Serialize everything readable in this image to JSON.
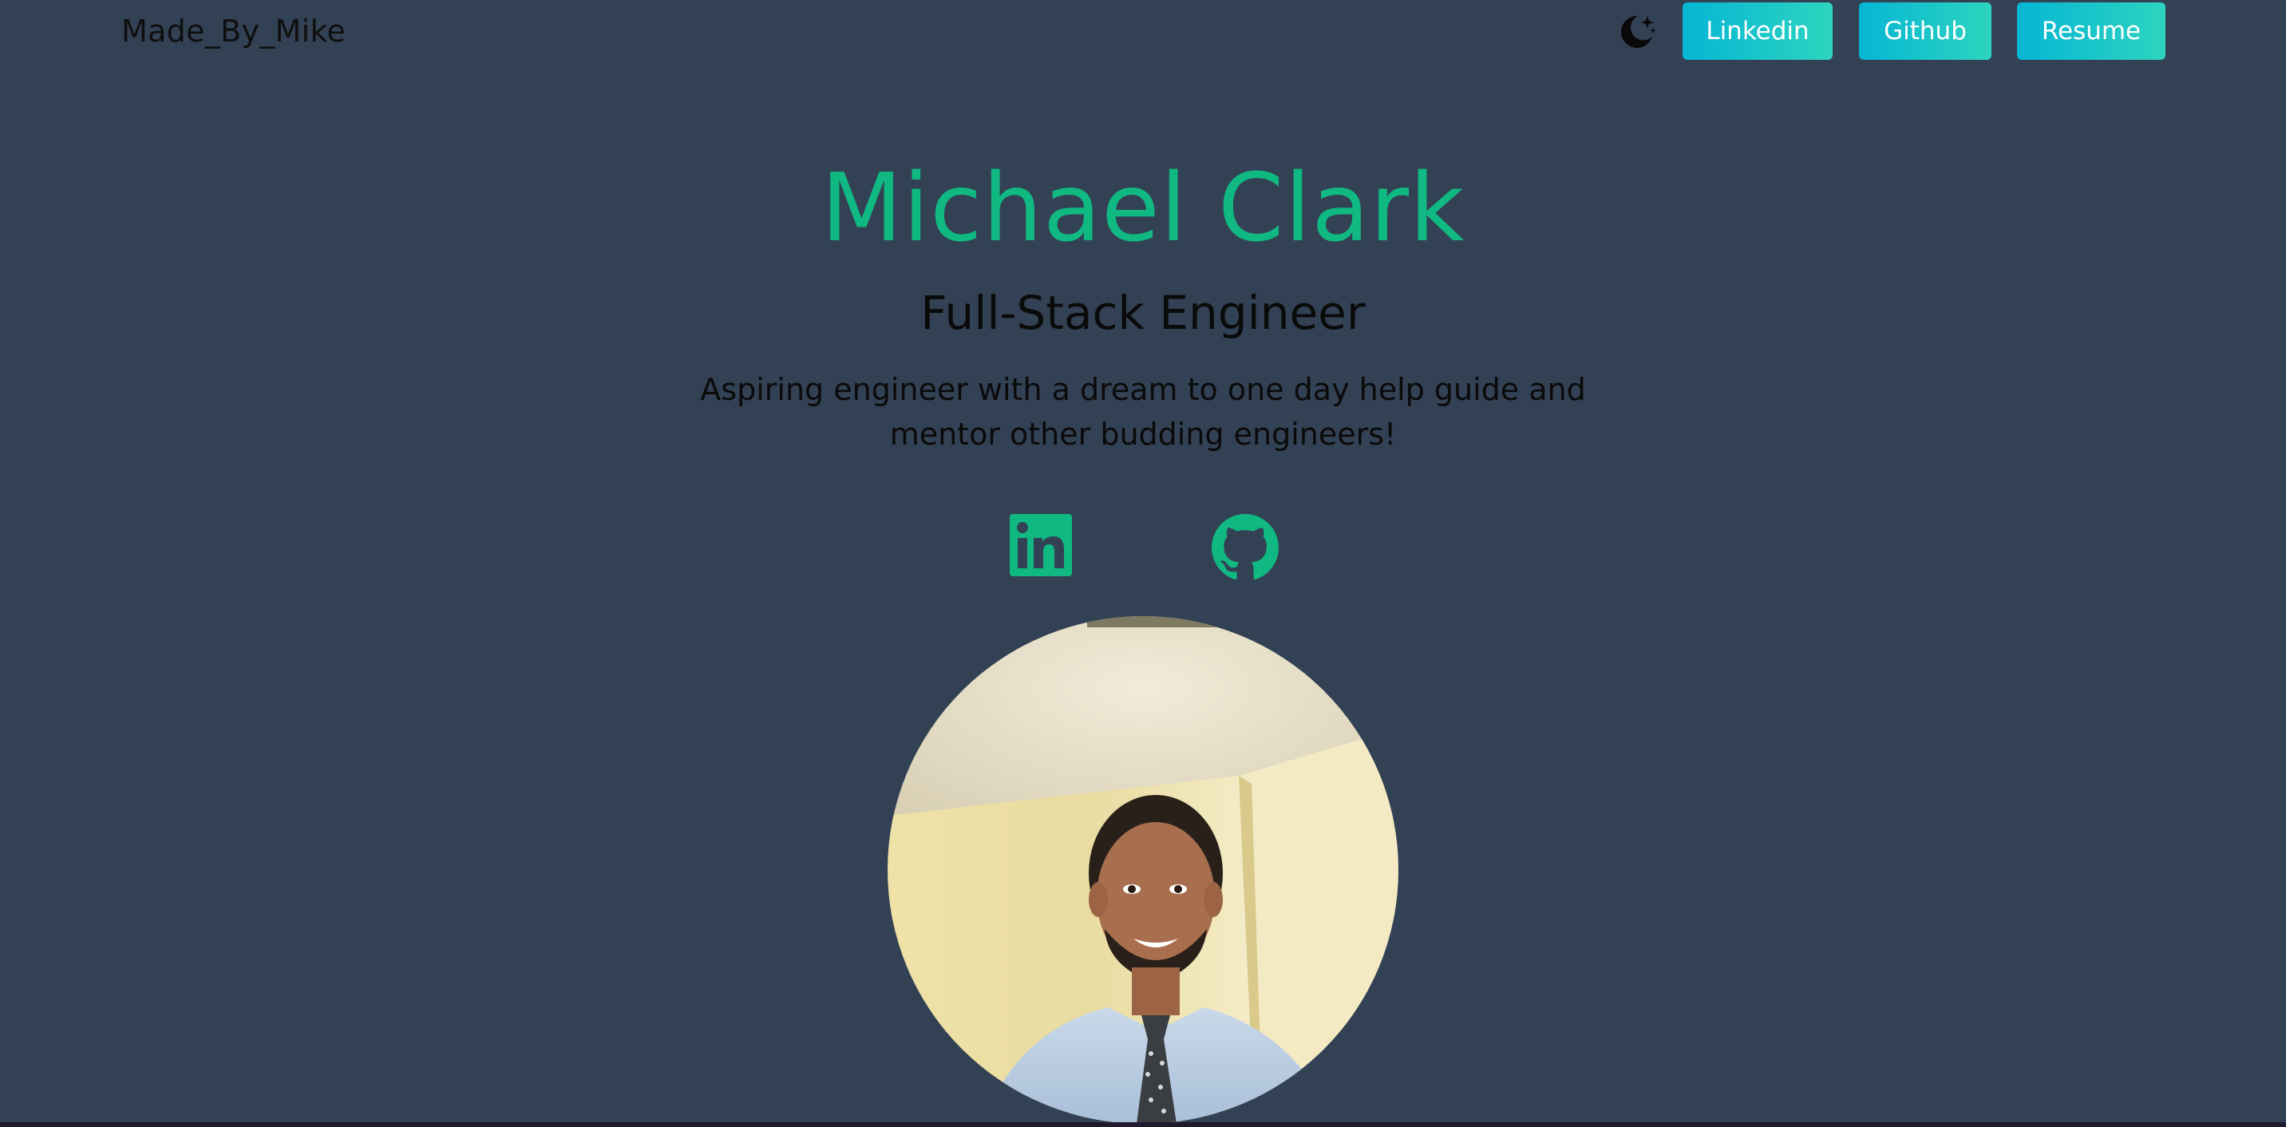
{
  "header": {
    "brand": "Made_By_Mike",
    "theme_icon": "moon-stars-icon",
    "nav": {
      "linkedin_label": "Linkedin",
      "github_label": "Github",
      "resume_label": "Resume"
    }
  },
  "hero": {
    "name": "Michael Clark",
    "role": "Full-Stack Engineer",
    "tagline": "Aspiring engineer with a dream to one day help guide and mentor other budding engineers!",
    "social": {
      "linkedin_icon": "linkedin-icon",
      "github_icon": "github-icon"
    },
    "avatar": "profile-photo"
  },
  "colors": {
    "background": "#334155",
    "accent": "#10b981",
    "button_gradient_start": "#06b6d4",
    "button_gradient_end": "#2dd4bf",
    "text": "#0a0a0a"
  }
}
